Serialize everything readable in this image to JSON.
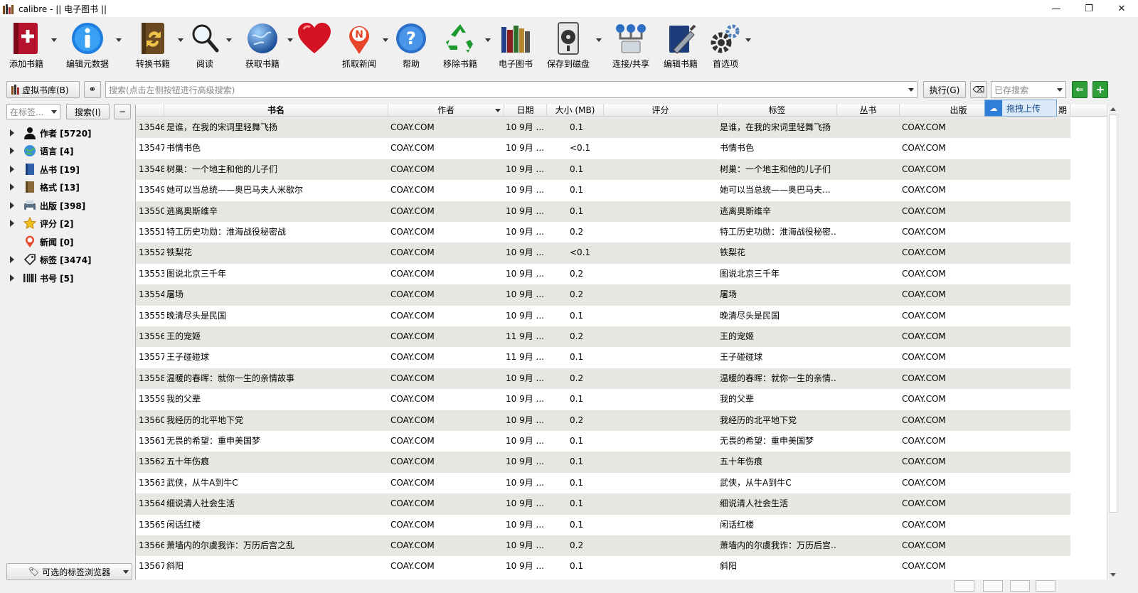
{
  "window": {
    "title": "calibre - || 电子图书 ||",
    "controls": [
      "—",
      "❐",
      "✕"
    ]
  },
  "toolbar": [
    {
      "id": "add",
      "label": "添加书籍",
      "icon": "add-book-icon",
      "has_menu": true
    },
    {
      "id": "edit_meta",
      "label": "编辑元数据",
      "icon": "info-icon",
      "has_menu": true
    },
    {
      "id": "convert",
      "label": "转换书籍",
      "icon": "convert-book-icon",
      "has_menu": true
    },
    {
      "id": "read",
      "label": "阅读",
      "icon": "magnifier-icon",
      "has_menu": true
    },
    {
      "id": "fetch",
      "label": "获取书籍",
      "icon": "globe-icon",
      "has_menu": true
    },
    {
      "id": "heart",
      "label": "",
      "icon": "heart-icon",
      "has_menu": false
    },
    {
      "id": "news",
      "label": "抓取新闻",
      "icon": "news-icon",
      "has_menu": true
    },
    {
      "id": "help",
      "label": "帮助",
      "icon": "help-icon",
      "has_menu": false
    },
    {
      "id": "remove",
      "label": "移除书籍",
      "icon": "recycle-icon",
      "has_menu": true
    },
    {
      "id": "library",
      "label": "电子图书",
      "icon": "library-icon",
      "has_menu": false
    },
    {
      "id": "save",
      "label": "保存到磁盘",
      "icon": "disk-icon",
      "has_menu": true
    },
    {
      "id": "connect",
      "label": "连接/共享",
      "icon": "network-icon",
      "has_menu": false
    },
    {
      "id": "edit_book",
      "label": "编辑书籍",
      "icon": "edit-book-icon",
      "has_menu": false
    },
    {
      "id": "prefs",
      "label": "首选项",
      "icon": "gear-icon",
      "has_menu": true
    }
  ],
  "searchbar": {
    "virtual_library": "虚拟书库(B)",
    "search_placeholder": "搜索(点击左侧按钮进行高级搜索)",
    "execute": "执行(G)",
    "saved_search_placeholder": "已存搜索"
  },
  "tagbrowser": {
    "filter_placeholder": "在标签...",
    "search_button": "搜索(I)",
    "minus_button": "−",
    "items": [
      {
        "label": "作者 [5720]",
        "icon": "person-icon"
      },
      {
        "label": "语言 [4]",
        "icon": "language-icon"
      },
      {
        "label": "丛书 [19]",
        "icon": "series-icon"
      },
      {
        "label": "格式 [13]",
        "icon": "format-icon"
      },
      {
        "label": "出版 [398]",
        "icon": "publisher-icon"
      },
      {
        "label": "评分 [2]",
        "icon": "star-icon"
      },
      {
        "label": "新闻 [0]",
        "icon": "news-icon"
      },
      {
        "label": "标签 [3474]",
        "icon": "tag-icon"
      },
      {
        "label": "书号 [5]",
        "icon": "barcode-icon"
      }
    ],
    "browser_button": "可选的标签浏览器"
  },
  "table": {
    "columns": [
      "书名",
      "作者",
      "日期",
      "大小 (MB)",
      "评分",
      "标签",
      "丛书",
      "出版",
      "期"
    ],
    "rows": [
      {
        "id": "13546",
        "title": "是谁，在我的宋词里轻舞飞扬",
        "author": "COAY.COM",
        "date": "10 9月 ...",
        "size": "0.1",
        "tags": "是谁，在我的宋词里轻舞飞扬",
        "publisher": "COAY.COM"
      },
      {
        "id": "13547",
        "title": "书情书色",
        "author": "COAY.COM",
        "date": "10 9月 ...",
        "size": "<0.1",
        "tags": "书情书色",
        "publisher": "COAY.COM"
      },
      {
        "id": "13548",
        "title": "树巢：一个地主和他的儿子们",
        "author": "COAY.COM",
        "date": "10 9月 ...",
        "size": "0.1",
        "tags": "树巢：一个地主和他的儿子们",
        "publisher": "COAY.COM"
      },
      {
        "id": "13549",
        "title": "她可以当总统——奥巴马夫人米歇尔",
        "author": "COAY.COM",
        "date": "10 9月 ...",
        "size": "0.1",
        "tags": "她可以当总统——奥巴马夫...",
        "publisher": "COAY.COM"
      },
      {
        "id": "13550",
        "title": "逃离奥斯维辛",
        "author": "COAY.COM",
        "date": "10 9月 ...",
        "size": "0.1",
        "tags": "逃离奥斯维辛",
        "publisher": "COAY.COM"
      },
      {
        "id": "13551",
        "title": "特工历史功勋：淮海战役秘密战",
        "author": "COAY.COM",
        "date": "10 9月 ...",
        "size": "0.2",
        "tags": "特工历史功勋：淮海战役秘密...",
        "publisher": "COAY.COM"
      },
      {
        "id": "13552",
        "title": "铁梨花",
        "author": "COAY.COM",
        "date": "10 9月 ...",
        "size": "<0.1",
        "tags": "铁梨花",
        "publisher": "COAY.COM"
      },
      {
        "id": "13553",
        "title": "图说北京三千年",
        "author": "COAY.COM",
        "date": "10 9月 ...",
        "size": "0.2",
        "tags": "图说北京三千年",
        "publisher": "COAY.COM"
      },
      {
        "id": "13554",
        "title": "屠场",
        "author": "COAY.COM",
        "date": "10 9月 ...",
        "size": "0.2",
        "tags": "屠场",
        "publisher": "COAY.COM"
      },
      {
        "id": "13555",
        "title": "晚清尽头是民国",
        "author": "COAY.COM",
        "date": "10 9月 ...",
        "size": "0.1",
        "tags": "晚清尽头是民国",
        "publisher": "COAY.COM"
      },
      {
        "id": "13556",
        "title": "王的宠姬",
        "author": "COAY.COM",
        "date": "11 9月 ...",
        "size": "0.2",
        "tags": "王的宠姬",
        "publisher": "COAY.COM"
      },
      {
        "id": "13557",
        "title": "王子碰碰球",
        "author": "COAY.COM",
        "date": "11 9月 ...",
        "size": "0.1",
        "tags": "王子碰碰球",
        "publisher": "COAY.COM"
      },
      {
        "id": "13558",
        "title": "温暖的春晖：就你一生的亲情故事",
        "author": "COAY.COM",
        "date": "10 9月 ...",
        "size": "0.2",
        "tags": "温暖的春晖：就你一生的亲情...",
        "publisher": "COAY.COM"
      },
      {
        "id": "13559",
        "title": "我的父辈",
        "author": "COAY.COM",
        "date": "10 9月 ...",
        "size": "0.1",
        "tags": "我的父辈",
        "publisher": "COAY.COM"
      },
      {
        "id": "13560",
        "title": "我经历的北平地下党",
        "author": "COAY.COM",
        "date": "10 9月 ...",
        "size": "0.2",
        "tags": "我经历的北平地下党",
        "publisher": "COAY.COM"
      },
      {
        "id": "13561",
        "title": "无畏的希望：重申美国梦",
        "author": "COAY.COM",
        "date": "10 9月 ...",
        "size": "0.1",
        "tags": "无畏的希望：重申美国梦",
        "publisher": "COAY.COM"
      },
      {
        "id": "13562",
        "title": "五十年伤痕",
        "author": "COAY.COM",
        "date": "10 9月 ...",
        "size": "0.1",
        "tags": "五十年伤痕",
        "publisher": "COAY.COM"
      },
      {
        "id": "13563",
        "title": "武侠，从牛A到牛C",
        "author": "COAY.COM",
        "date": "10 9月 ...",
        "size": "0.1",
        "tags": "武侠，从牛A到牛C",
        "publisher": "COAY.COM"
      },
      {
        "id": "13564",
        "title": "细说清人社会生活",
        "author": "COAY.COM",
        "date": "10 9月 ...",
        "size": "0.1",
        "tags": "细说清人社会生活",
        "publisher": "COAY.COM"
      },
      {
        "id": "13565",
        "title": "闲话红楼",
        "author": "COAY.COM",
        "date": "10 9月 ...",
        "size": "0.1",
        "tags": "闲话红楼",
        "publisher": "COAY.COM"
      },
      {
        "id": "13566",
        "title": "萧墙内的尔虞我诈：万历后宫之乱",
        "author": "COAY.COM",
        "date": "10 9月 ...",
        "size": "0.2",
        "tags": "萧墙内的尔虞我诈：万历后宫...",
        "publisher": "COAY.COM"
      },
      {
        "id": "13567",
        "title": "斜阳",
        "author": "COAY.COM",
        "date": "10 9月 ...",
        "size": "0.1",
        "tags": "斜阳",
        "publisher": "COAY.COM"
      }
    ]
  },
  "popup": {
    "label": "拖拽上传"
  },
  "colors": {
    "row_alt": "#e8e6e1",
    "accent_blue": "#2f7fd8"
  }
}
